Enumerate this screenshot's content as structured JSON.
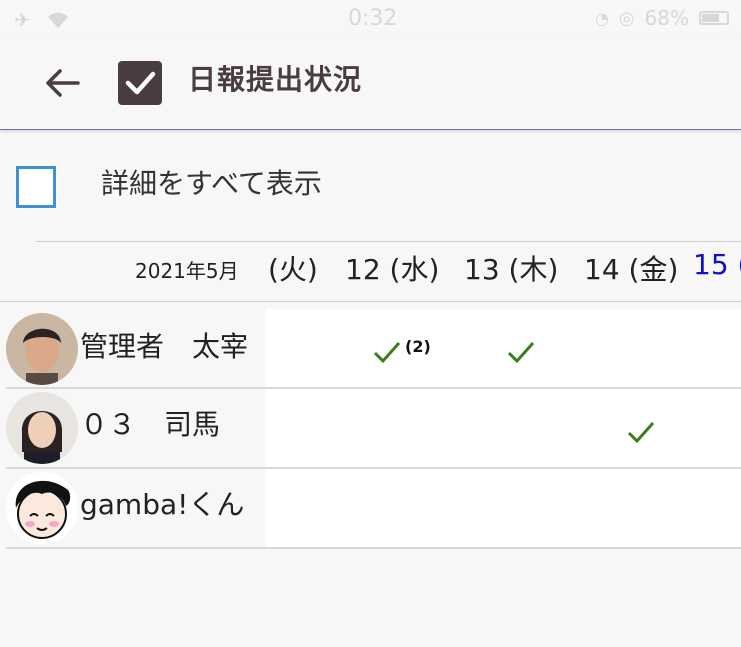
{
  "status_bar": {
    "time": "0:32",
    "battery": "68%"
  },
  "header": {
    "title": "日報提出状況"
  },
  "show_all": {
    "label": "詳細をすべて表示",
    "checked": false
  },
  "calendar": {
    "month": "2021年5月",
    "days": [
      {
        "label": "(火)",
        "highlight": false
      },
      {
        "label": "12 (水)",
        "highlight": false
      },
      {
        "label": "13 (木)",
        "highlight": false
      },
      {
        "label": "14 (金)",
        "highlight": false
      },
      {
        "label": "15 (",
        "highlight": true
      }
    ]
  },
  "members": [
    {
      "name": "管理者　太宰",
      "avatar": "man-avatar",
      "checks": [
        {
          "day": 1,
          "count": "(2)"
        },
        {
          "day": 2,
          "count": ""
        }
      ]
    },
    {
      "name": "０３　司馬",
      "avatar": "woman-avatar",
      "checks": [
        {
          "day": 3,
          "count": ""
        }
      ]
    },
    {
      "name": "gamba!くん",
      "avatar": "cartoon-avatar",
      "checks": []
    }
  ],
  "colors": {
    "accent": "#3d8fd6",
    "check_green": "#3a7d1e",
    "header_text": "#4a3d3f",
    "weekend_blue": "#1010cc"
  }
}
